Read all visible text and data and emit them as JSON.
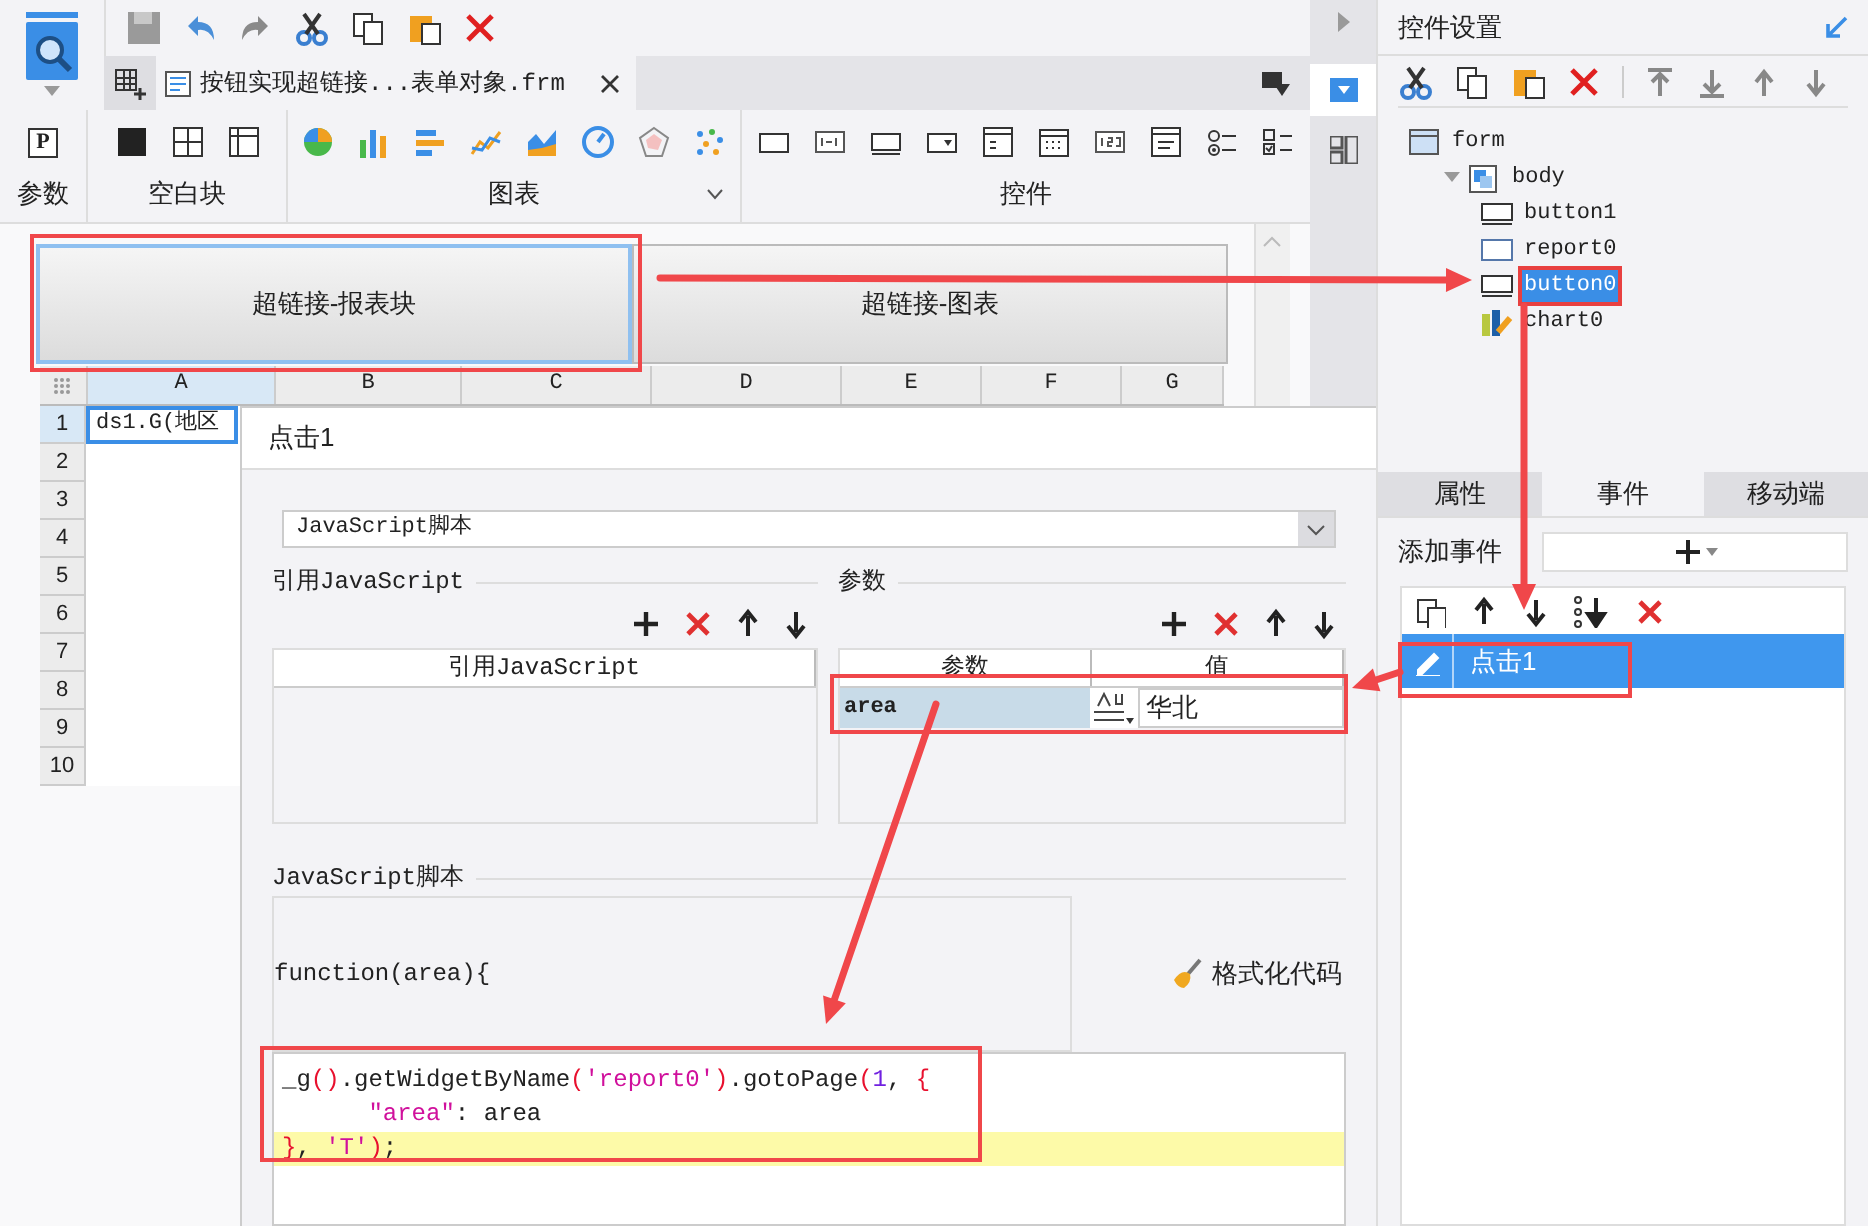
{
  "file_tab": {
    "label": "按钮实现超链接...表单对象.frm"
  },
  "ribbon_groups": [
    {
      "kind": "param",
      "label": "参数",
      "icon_text": "P"
    },
    {
      "kind": "blank",
      "label": "空白块"
    },
    {
      "kind": "chart",
      "label": "图表"
    },
    {
      "kind": "control",
      "label": "控件"
    }
  ],
  "canvas": {
    "buttons": [
      {
        "label": "超链接-报表块",
        "selected": true
      },
      {
        "label": "超链接-图表",
        "selected": false
      }
    ],
    "columns": [
      {
        "label": "A",
        "selected": true
      },
      {
        "label": "B",
        "selected": false
      },
      {
        "label": "C",
        "selected": false
      },
      {
        "label": "D",
        "selected": false
      },
      {
        "label": "E",
        "selected": false
      },
      {
        "label": "F",
        "selected": false
      },
      {
        "label": "G",
        "selected": false
      }
    ],
    "rows": [
      {
        "label": "1",
        "selected": true
      },
      {
        "label": "2",
        "selected": false
      },
      {
        "label": "3",
        "selected": false
      },
      {
        "label": "4",
        "selected": false
      },
      {
        "label": "5",
        "selected": false
      },
      {
        "label": "6",
        "selected": false
      },
      {
        "label": "7",
        "selected": false
      },
      {
        "label": "8",
        "selected": false
      },
      {
        "label": "9",
        "selected": false
      },
      {
        "label": "10",
        "selected": false
      }
    ],
    "cell_a1": "ds1.G(地区"
  },
  "dialog": {
    "title": "点击1",
    "script_type": "JavaScript脚本",
    "ref_section": {
      "title": "引用JavaScript",
      "column": "引用JavaScript"
    },
    "params_section": {
      "title": "参数",
      "columns": [
        "参数",
        "值"
      ],
      "rows": [
        {
          "name": "area",
          "value": "华北"
        }
      ]
    },
    "script_section": {
      "title": "JavaScript脚本",
      "signature": "function(area){",
      "format_button": "格式化代码",
      "code_lines": [
        {
          "highlighted": false,
          "tokens": [
            {
              "kind": "plain",
              "text": "_g"
            },
            {
              "kind": "bracket",
              "text": "()"
            },
            {
              "kind": "plain",
              "text": ".getWidgetByName"
            },
            {
              "kind": "bracket",
              "text": "("
            },
            {
              "kind": "string",
              "text": "'report0'"
            },
            {
              "kind": "bracket",
              "text": ")"
            },
            {
              "kind": "plain",
              "text": ".gotoPage"
            },
            {
              "kind": "bracket",
              "text": "("
            },
            {
              "kind": "number",
              "text": "1"
            },
            {
              "kind": "plain",
              "text": ", "
            },
            {
              "kind": "bracket",
              "text": "{"
            }
          ]
        },
        {
          "highlighted": false,
          "tokens": [
            {
              "kind": "string",
              "text": "      \"area\""
            },
            {
              "kind": "plain",
              "text": ": area"
            }
          ]
        },
        {
          "highlighted": true,
          "tokens": [
            {
              "kind": "bracket",
              "text": "}"
            },
            {
              "kind": "plain",
              "text": ", "
            },
            {
              "kind": "string",
              "text": "'T'"
            },
            {
              "kind": "bracket",
              "text": ")"
            },
            {
              "kind": "plain",
              "text": ";"
            }
          ]
        }
      ]
    }
  },
  "right_panel": {
    "title": "控件设置",
    "tree": [
      {
        "kind": "form",
        "label": "form",
        "selected": false,
        "children": [
          {
            "kind": "body",
            "label": "body",
            "selected": false,
            "expanded": true,
            "children": [
              {
                "kind": "button",
                "label": "button1",
                "selected": false
              },
              {
                "kind": "report",
                "label": "report0",
                "selected": false
              },
              {
                "kind": "button",
                "label": "button0",
                "selected": true
              },
              {
                "kind": "chart",
                "label": "chart0",
                "selected": false
              }
            ]
          }
        ]
      }
    ],
    "tabs": [
      {
        "label": "属性",
        "selected": false
      },
      {
        "label": "事件",
        "selected": true
      },
      {
        "label": "移动端",
        "selected": false
      }
    ],
    "add_event_label": "添加事件",
    "events": [
      {
        "label": "点击1",
        "selected": true
      }
    ]
  }
}
